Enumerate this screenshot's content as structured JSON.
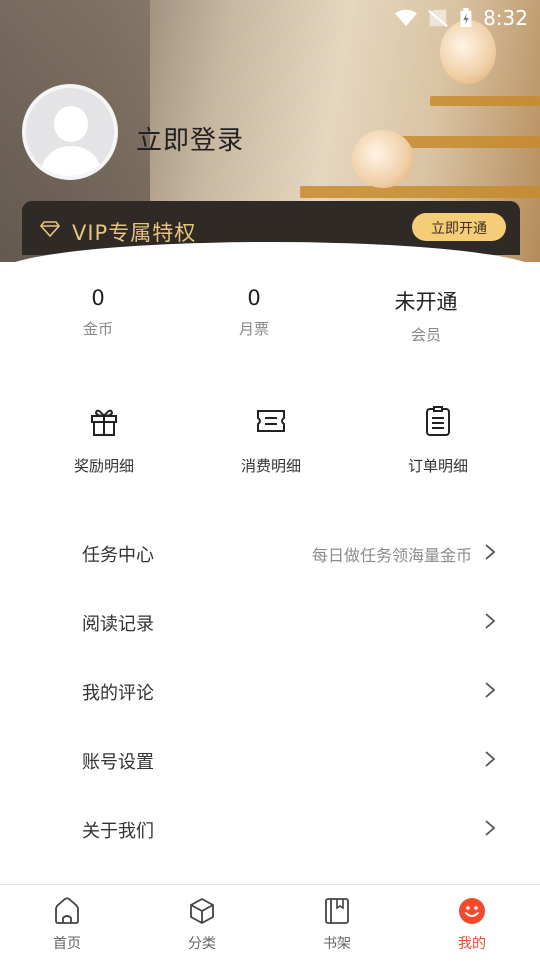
{
  "status_bar": {
    "time": "8:32"
  },
  "profile": {
    "login_label": "立即登录"
  },
  "vip": {
    "title": "VIP专属特权",
    "button_label": "立即开通"
  },
  "stats": [
    {
      "value": "0",
      "label": "金币"
    },
    {
      "value": "0",
      "label": "月票"
    },
    {
      "value": "未开通",
      "label": "会员"
    }
  ],
  "shortcuts": [
    {
      "label": "奖励明细",
      "icon": "gift-icon"
    },
    {
      "label": "消费明细",
      "icon": "ticket-icon"
    },
    {
      "label": "订单明细",
      "icon": "order-list-icon"
    }
  ],
  "menu": [
    {
      "label": "任务中心",
      "hint": "每日做任务领海量金币"
    },
    {
      "label": "阅读记录",
      "hint": ""
    },
    {
      "label": "我的评论",
      "hint": ""
    },
    {
      "label": "账号设置",
      "hint": ""
    },
    {
      "label": "关于我们",
      "hint": ""
    }
  ],
  "bottom_nav": [
    {
      "label": "首页",
      "icon": "home-icon"
    },
    {
      "label": "分类",
      "icon": "category-cube-icon"
    },
    {
      "label": "书架",
      "icon": "bookshelf-icon"
    },
    {
      "label": "我的",
      "icon": "smiley-icon",
      "active": true
    }
  ],
  "colors": {
    "accent": "#f04a2a",
    "vip_gold": "#e6c37e",
    "vip_button": "#f5cd79"
  }
}
